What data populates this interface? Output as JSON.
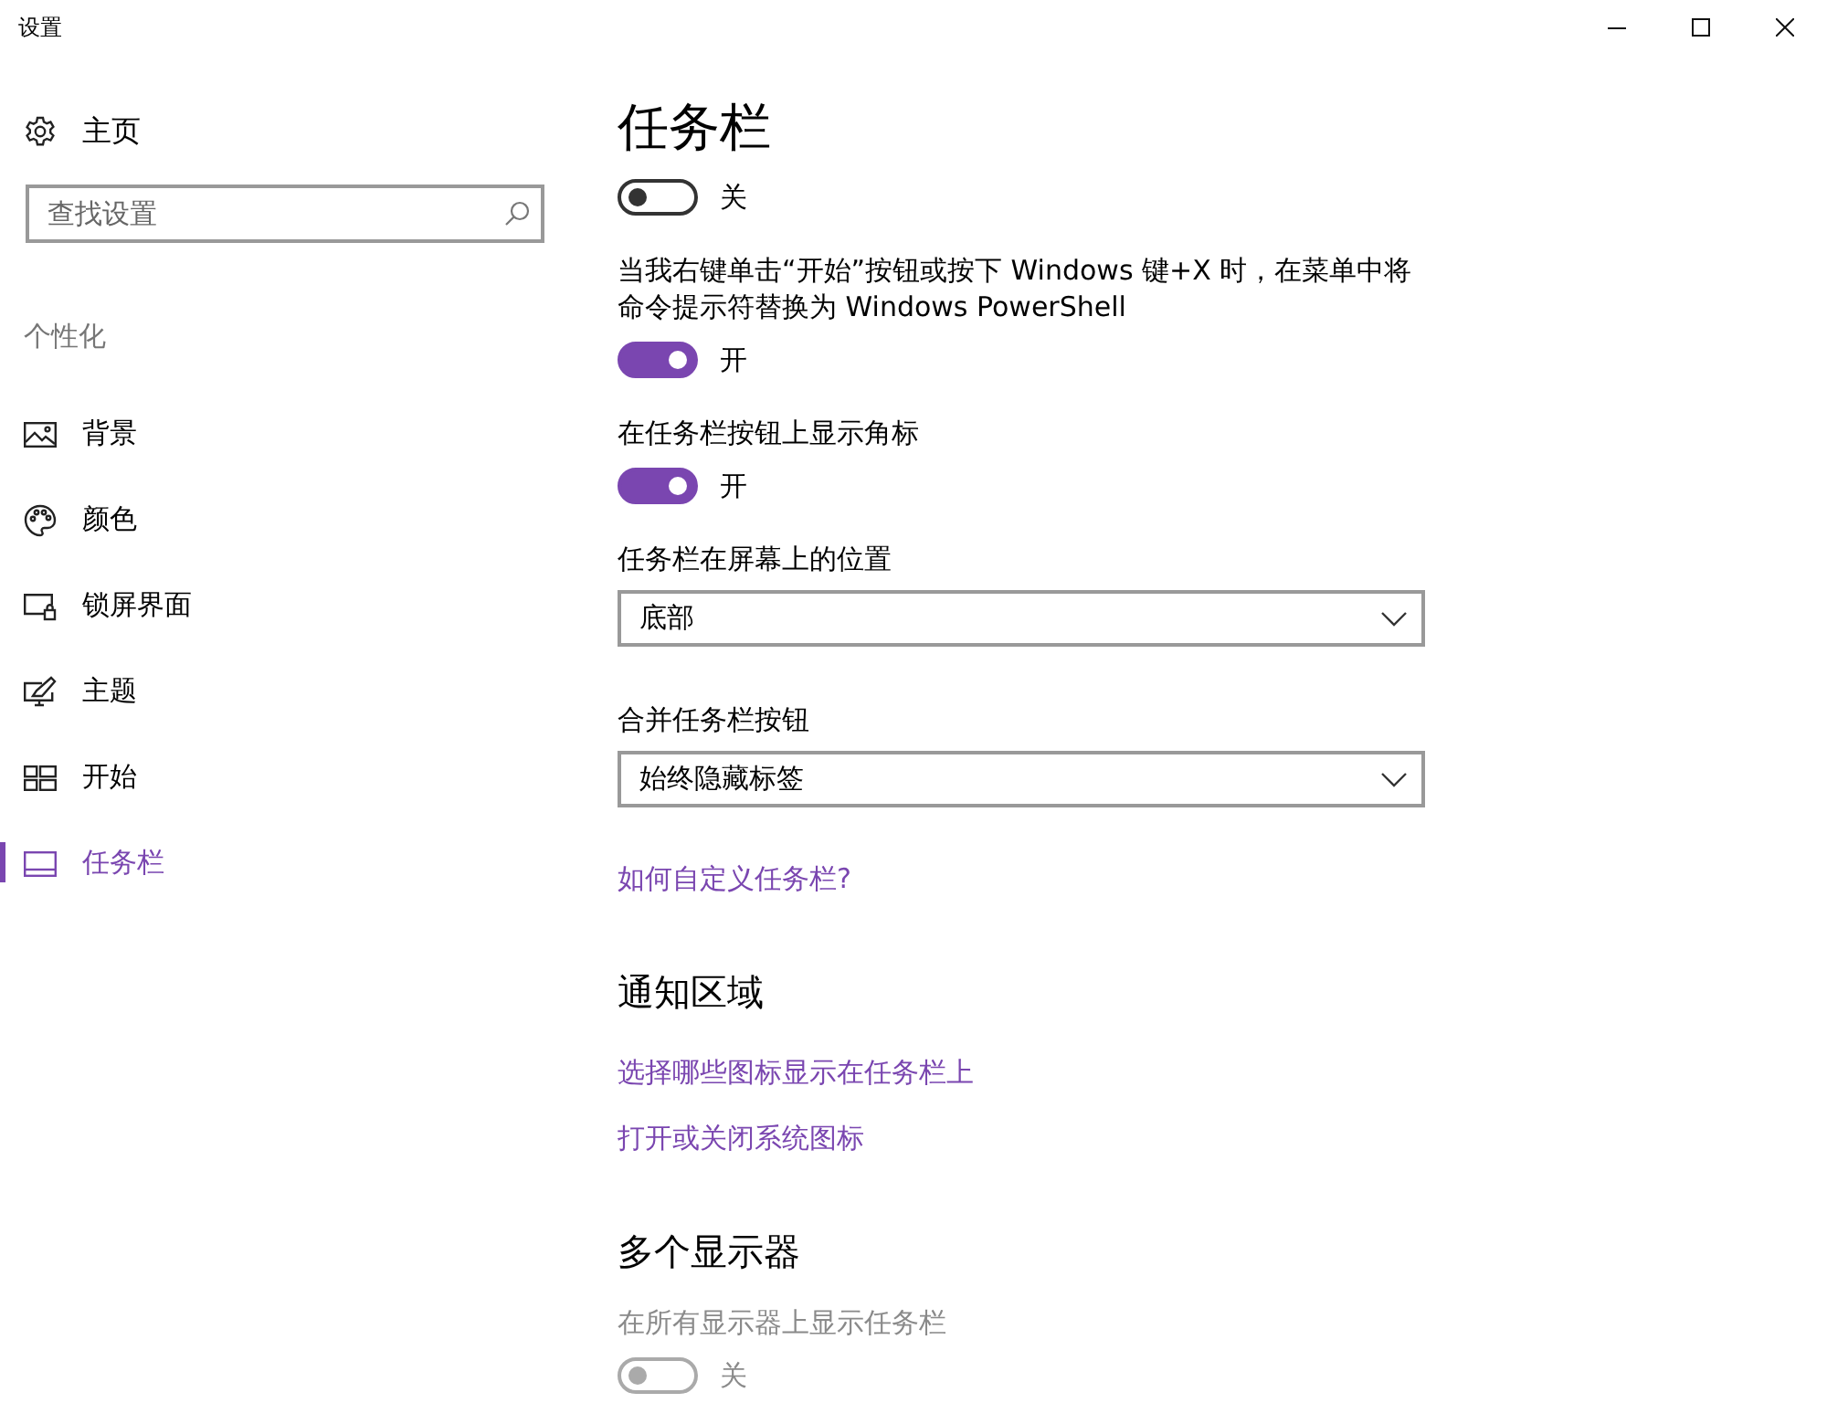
{
  "window": {
    "title": "设置"
  },
  "sidebar": {
    "home": "主页",
    "search": {
      "placeholder": "查找设置"
    },
    "section": "个性化",
    "items": [
      {
        "label": "背景",
        "kind": "picture",
        "selected": false
      },
      {
        "label": "颜色",
        "kind": "palette",
        "selected": false
      },
      {
        "label": "锁屏界面",
        "kind": "lockscreen",
        "selected": false
      },
      {
        "label": "主题",
        "kind": "theme",
        "selected": false
      },
      {
        "label": "开始",
        "kind": "start",
        "selected": false
      },
      {
        "label": "任务栏",
        "kind": "taskbar",
        "selected": true
      }
    ]
  },
  "page": {
    "title": "任务栏",
    "items": [
      {
        "kind": "toggle",
        "on": false,
        "disabled": false,
        "state_text": "关"
      },
      {
        "kind": "toggle",
        "label": "当我右键单击“开始”按钮或按下 Windows 键+X 时，在菜单中将命令提示符替换为 Windows PowerShell",
        "on": true,
        "disabled": false,
        "state_text": "开"
      },
      {
        "kind": "toggle",
        "label": "在任务栏按钮上显示角标",
        "on": true,
        "disabled": false,
        "state_text": "开"
      },
      {
        "kind": "dropdown",
        "label": "任务栏在屏幕上的位置",
        "value": "底部"
      },
      {
        "kind": "dropdown",
        "label": "合并任务栏按钮",
        "value": "始终隐藏标签"
      },
      {
        "kind": "link",
        "text": "如何自定义任务栏?"
      },
      {
        "kind": "heading",
        "text": "通知区域"
      },
      {
        "kind": "link",
        "text": "选择哪些图标显示在任务栏上"
      },
      {
        "kind": "link",
        "text": "打开或关闭系统图标"
      },
      {
        "kind": "heading",
        "text": "多个显示器"
      },
      {
        "kind": "toggle",
        "label": "在所有显示器上显示任务栏",
        "on": false,
        "disabled": true,
        "state_text": "关"
      }
    ]
  }
}
